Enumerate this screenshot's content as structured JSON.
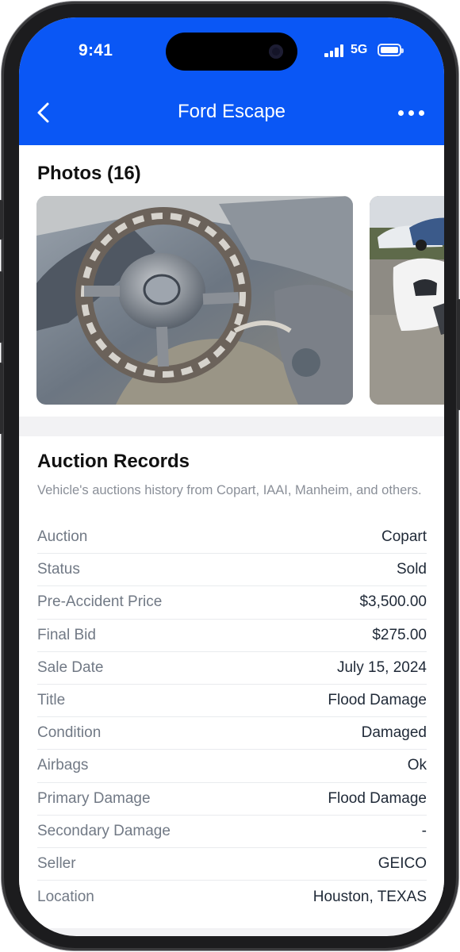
{
  "status_bar": {
    "time": "9:41",
    "network": "5G"
  },
  "nav": {
    "title": "Ford Escape",
    "back_icon": "chevron-left-icon",
    "more_icon": "ellipsis-icon"
  },
  "colors": {
    "header": "#0a57f5",
    "label": "#717985",
    "value": "#1f2937",
    "subtitle": "#8a8f98"
  },
  "photos": {
    "title": "Photos (16)",
    "items": [
      "car interior covered in flood mud",
      "white car in gravel lot"
    ]
  },
  "auction": {
    "title": "Auction Records",
    "subtitle": "Vehicle's auctions history from Copart, IAAI, Manheim, and others.",
    "rows": [
      {
        "label": "Auction",
        "value": "Copart"
      },
      {
        "label": "Status",
        "value": "Sold"
      },
      {
        "label": "Pre-Accident Price",
        "value": "$3,500.00"
      },
      {
        "label": "Final Bid",
        "value": "$275.00"
      },
      {
        "label": "Sale Date",
        "value": "July 15, 2024"
      },
      {
        "label": "Title",
        "value": "Flood Damage"
      },
      {
        "label": "Condition",
        "value": "Damaged"
      },
      {
        "label": "Airbags",
        "value": "Ok"
      },
      {
        "label": "Primary Damage",
        "value": "Flood Damage"
      },
      {
        "label": "Secondary Damage",
        "value": "-"
      },
      {
        "label": "Seller",
        "value": "GEICO"
      },
      {
        "label": "Location",
        "value": "Houston, TEXAS"
      }
    ]
  }
}
